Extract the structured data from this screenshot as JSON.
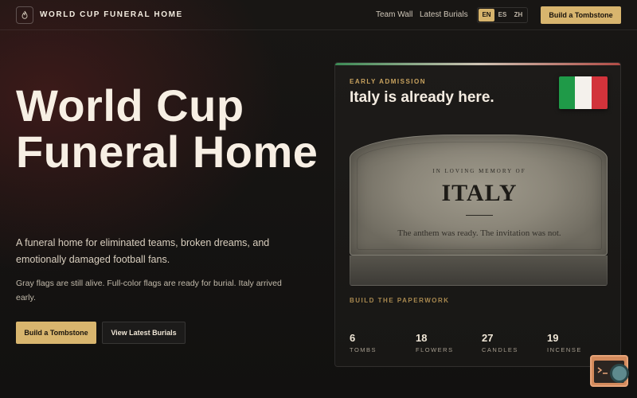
{
  "nav": {
    "brand": "WORLD CUP FUNERAL HOME",
    "brand_icon": "flame-icon",
    "links": [
      "Team Wall",
      "Latest Burials"
    ],
    "languages": [
      "EN",
      "ES",
      "ZH"
    ],
    "active_language": "EN",
    "cta": "Build a Tombstone"
  },
  "hero": {
    "title": "World Cup Funeral Home",
    "subtitle": "A funeral home for eliminated teams, broken dreams, and emotionally damaged football fans.",
    "note": "Gray flags are still alive. Full-color flags are ready for burial. Italy arrived early.",
    "primary_button": "Build a Tombstone",
    "secondary_button": "View Latest Burials"
  },
  "card": {
    "eyebrow": "EARLY ADMISSION",
    "headline": "Italy is already here.",
    "flag_colors": [
      "#1f9a48",
      "#f4f1ec",
      "#d2333b"
    ],
    "tombstone": {
      "memory": "IN LOVING MEMORY OF",
      "name": "ITALY",
      "epitaph": "The anthem was ready. The invitation was not."
    },
    "paperwork": "BUILD THE PAPERWORK",
    "stats": [
      {
        "value": "6",
        "label": "TOMBS"
      },
      {
        "value": "18",
        "label": "FLOWERS"
      },
      {
        "value": "27",
        "label": "CANDLES"
      },
      {
        "value": "19",
        "label": "INCENSE"
      }
    ]
  },
  "colors": {
    "accent": "#d8b56e",
    "background": "#141311"
  }
}
